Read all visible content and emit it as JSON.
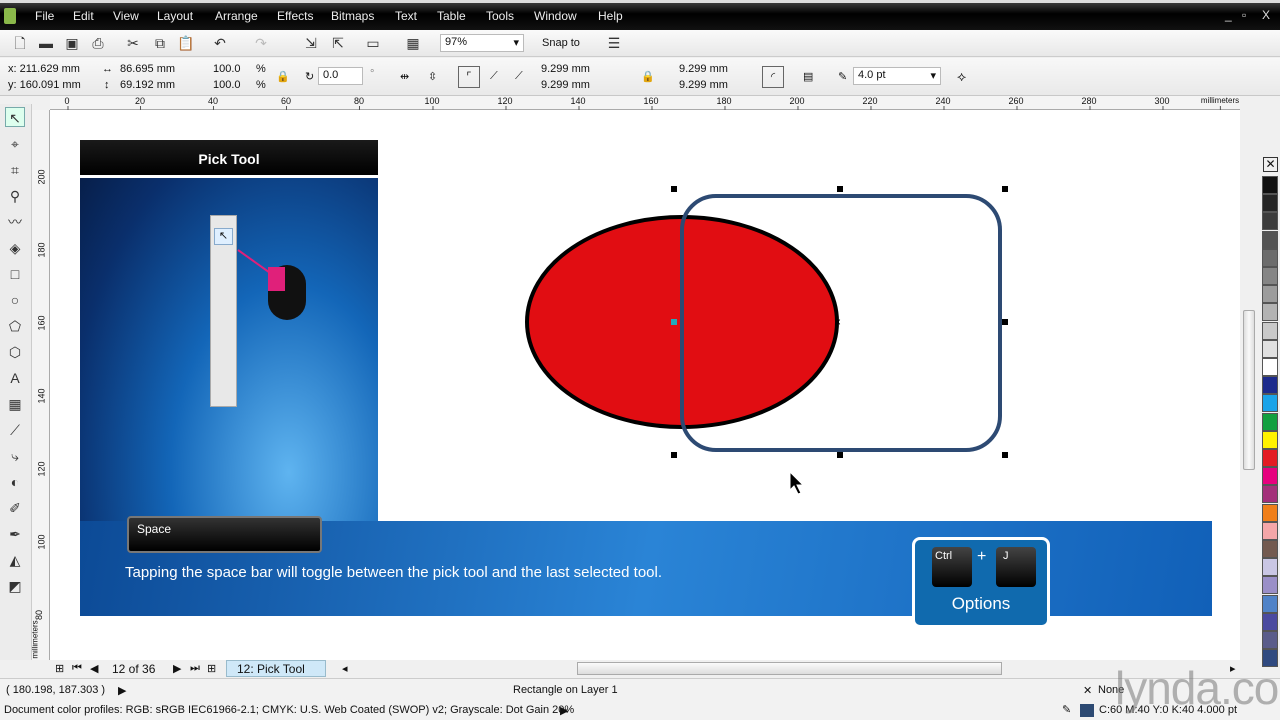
{
  "menu": [
    "File",
    "Edit",
    "View",
    "Layout",
    "Arrange",
    "Effects",
    "Bitmaps",
    "Text",
    "Table",
    "Tools",
    "Window",
    "Help"
  ],
  "window_controls": {
    "minimize": "_",
    "restore": "▫",
    "close": "X"
  },
  "toolbar": {
    "zoom": "97%",
    "snap": "Snap to"
  },
  "props": {
    "x": "x: 211.629 mm",
    "y": "y: 160.091 mm",
    "w": "86.695 mm",
    "h": "69.192 mm",
    "sx": "100.0",
    "sy": "100.0",
    "pct": "%",
    "angle": "0.0",
    "deg": "°",
    "corner1": "9.299 mm",
    "corner2": "9.299 mm",
    "corner3": "9.299 mm",
    "corner4": "9.299 mm",
    "outline": "4.0 pt"
  },
  "hruler": {
    "ticks": [
      "0",
      "20",
      "40",
      "60",
      "80",
      "100",
      "120",
      "140",
      "160",
      "180",
      "200",
      "220",
      "240",
      "260",
      "280",
      "300"
    ],
    "unit": "millimeters"
  },
  "vruler": {
    "ticks": [
      "200",
      "180",
      "160",
      "140",
      "120",
      "100",
      "80"
    ],
    "unit": "millimeters"
  },
  "overlay": {
    "title": "Pick Tool",
    "key": "Space",
    "caption": "Tapping the space bar will toggle between the pick tool and the last selected tool.",
    "shortcut_key1": "Ctrl",
    "shortcut_plus": "+",
    "shortcut_key2": "J",
    "shortcut_label": "Options"
  },
  "drawing": {
    "ellipse_fill": "#e10d12",
    "rect_outline": "#2d4a73"
  },
  "pages": {
    "position": "12 of 36",
    "tab": "12: Pick Tool"
  },
  "status": {
    "coords": "( 180.198, 187.303 )",
    "object": "Rectangle on Layer 1",
    "profiles": "Document color profiles: RGB: sRGB IEC61966-2.1; CMYK: U.S. Web Coated (SWOP) v2; Grayscale: Dot Gain 20%",
    "fill": "None",
    "outline": "C:60 M:40 Y:0 K:40  4.000 pt"
  },
  "watermark": "lynda.com",
  "palette": [
    "#111111",
    "#262626",
    "#3c3c3c",
    "#545454",
    "#6c6c6c",
    "#858585",
    "#9c9c9c",
    "#b3b3b3",
    "#c9c9c9",
    "#e0e0e0",
    "#ffffff",
    "#1c2a8c",
    "#1aa3e8",
    "#12a040",
    "#fff200",
    "#e31b23",
    "#e6007e",
    "#a3307a",
    "#f07f1a",
    "#f4a6a8",
    "#735a50",
    "#c9c6e4",
    "#9a8fc8",
    "#5083c8",
    "#4a4aa0",
    "#5a5c8a",
    "#304a80"
  ]
}
